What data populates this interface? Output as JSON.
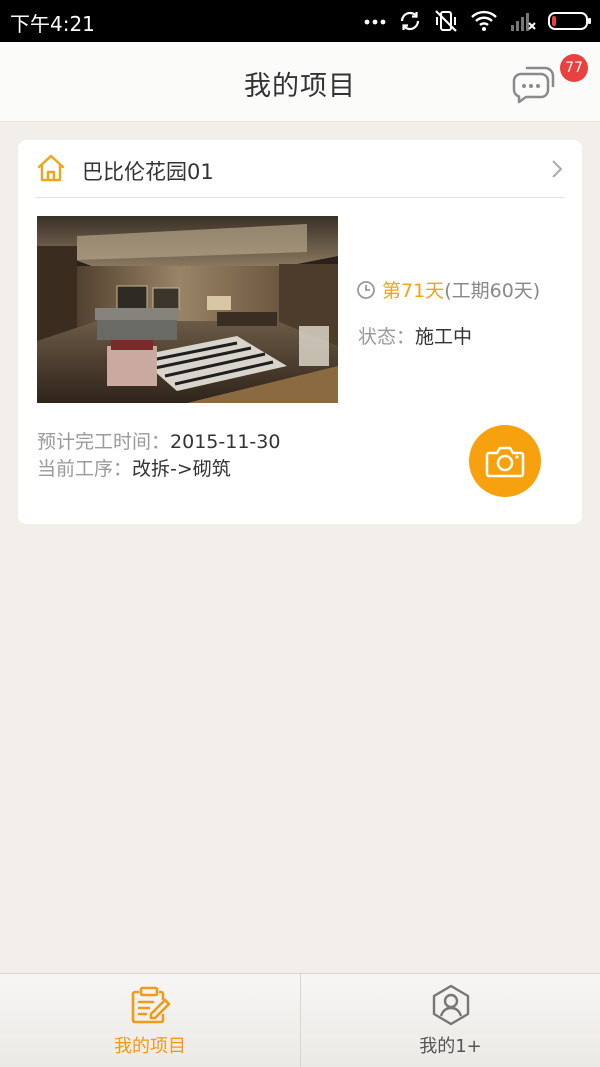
{
  "status_bar": {
    "time": "下午4:21",
    "icons": [
      "more-dots-icon",
      "sync-icon",
      "vibrate-off-icon",
      "wifi-icon",
      "signal-off-icon",
      "battery-low-icon"
    ]
  },
  "header": {
    "title": "我的项目",
    "message_badge": "77",
    "icon": "chat-bubble-icon"
  },
  "project": {
    "name": "巴比伦花园01",
    "day_current": "第71天",
    "day_total": "(工期60天)",
    "status_label": "状态：",
    "status_value": "施工中",
    "finish_label": "预计完工时间：",
    "finish_value": "2015-11-30",
    "process_label": "当前工序：",
    "process_value": "改拆->砌筑"
  },
  "tabs": [
    {
      "label": "我的项目",
      "icon": "notebook-edit-icon",
      "active": true
    },
    {
      "label": "我的1+",
      "icon": "user-hexagon-icon",
      "active": false
    }
  ],
  "colors": {
    "accent": "#f8a10f",
    "badge": "#e8413f",
    "background": "#f2efeb"
  }
}
